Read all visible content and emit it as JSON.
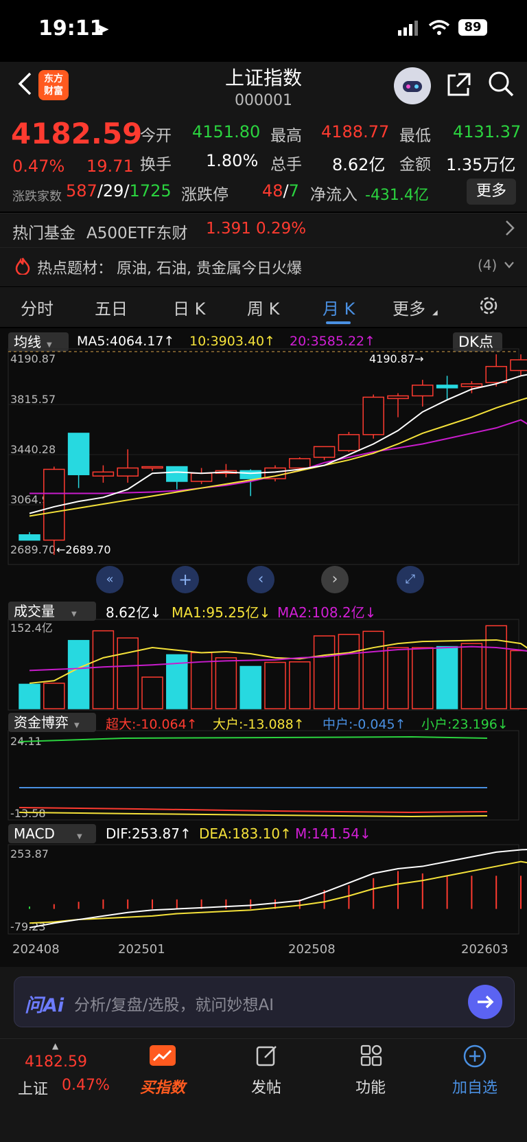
{
  "status_bar": {
    "time": "19:11",
    "battery": "89"
  },
  "header": {
    "title": "上证指数",
    "code": "000001",
    "logo_line1": "东方",
    "logo_line2": "财富"
  },
  "quote": {
    "price": "4182.59",
    "change_pct": "0.47%",
    "change": "19.71",
    "open_label": "今开",
    "open": "4151.80",
    "high_label": "最高",
    "high": "4188.77",
    "low_label": "最低",
    "low": "4131.37",
    "turnover_label": "换手",
    "turnover": "1.80%",
    "volume_label": "总手",
    "volume": "8.62亿",
    "amount_label": "金额",
    "amount": "1.35万亿",
    "breadth_label": "涨跌家数",
    "breadth_up": "587",
    "breadth_sep1": "/",
    "breadth_flat": "29",
    "breadth_sep2": "/",
    "breadth_down": "1725",
    "limit_label": "涨跌停",
    "limit_up": "48",
    "limit_sep": "/",
    "limit_down": "7",
    "netflow_label": "净流入",
    "netflow": "-431.4亿",
    "more": "更多"
  },
  "fund": {
    "label": "热门基金",
    "name": "A500ETF东财",
    "price": "1.391",
    "pct": "0.29%"
  },
  "hot": {
    "label": "热点题材：",
    "text": "原油, 石油, 贵金属今日火爆",
    "count": "(4)"
  },
  "tabs": [
    "分时",
    "五日",
    "日 K",
    "周 K",
    "月 K",
    "更多"
  ],
  "active_tab": "月 K",
  "ma": {
    "selector": "均线",
    "ma5": "MA5:4064.17↑",
    "ma10": "10:3903.40↑",
    "ma20": "20:3585.22↑",
    "dk": "DK点"
  },
  "price_axis": {
    "top": "4190.87",
    "l2": "3815.57",
    "l3": "3440.28",
    "l4": "3064.99",
    "bottom": "2689.70",
    "max_mark": "4190.87→",
    "min_mark": "←2689.70"
  },
  "volume_panel": {
    "selector": "成交量",
    "vol": "8.62亿↓",
    "ma1": "MA1:95.25亿↓",
    "ma2": "MA2:108.2亿↓",
    "top": "152.4亿"
  },
  "fund_panel": {
    "selector": "资金博弈",
    "super": "超大:-10.064↑",
    "large": "大户:-13.088↑",
    "mid": "中户:-0.045↑",
    "small": "小户:23.196↓",
    "top": "24.11",
    "bottom": "-13.58"
  },
  "macd_panel": {
    "selector": "MACD",
    "dif": "DIF:253.87↑",
    "dea": "DEA:183.10↑",
    "m": "M:141.54↓",
    "top": "253.87",
    "bottom": "-79.23"
  },
  "dates": [
    "202408",
    "202501",
    "202508",
    "202603"
  ],
  "ai": {
    "logo": "问Ai",
    "placeholder": "分析/复盘/选股，就问妙想AI"
  },
  "bottom": {
    "index_price": "4182.59",
    "index_name": "上证",
    "index_pct": "0.47%",
    "buy": "买指数",
    "post": "发帖",
    "func": "功能",
    "watch": "加自选"
  },
  "colors": {
    "up": "#ff3b30",
    "down": "#2bd33f",
    "bear_fill": "#27d9e0",
    "ma5": "#ffffff",
    "ma10": "#f5e23a",
    "ma20": "#c81ccc",
    "accent": "#4a90e2"
  },
  "chart_data": {
    "type": "candlestick",
    "candles": [
      {
        "o": 2840,
        "h": 2860,
        "l": 2800,
        "c": 2800
      },
      {
        "o": 2800,
        "h": 3350,
        "l": 2689.7,
        "c": 3330
      },
      {
        "o": 3600,
        "h": 3600,
        "l": 3190,
        "c": 3290
      },
      {
        "o": 3280,
        "h": 3360,
        "l": 3230,
        "c": 3310
      },
      {
        "o": 3280,
        "h": 3480,
        "l": 3230,
        "c": 3340
      },
      {
        "o": 3340,
        "h": 3350,
        "l": 3320,
        "c": 3350
      },
      {
        "o": 3350,
        "h": 3350,
        "l": 3180,
        "c": 3240
      },
      {
        "o": 3240,
        "h": 3340,
        "l": 3220,
        "c": 3300
      },
      {
        "o": 3300,
        "h": 3370,
        "l": 3270,
        "c": 3320
      },
      {
        "o": 3320,
        "h": 3330,
        "l": 3130,
        "c": 3260
      },
      {
        "o": 3260,
        "h": 3360,
        "l": 3240,
        "c": 3340
      },
      {
        "o": 3340,
        "h": 3420,
        "l": 3320,
        "c": 3410
      },
      {
        "o": 3420,
        "h": 3500,
        "l": 3400,
        "c": 3500
      },
      {
        "o": 3470,
        "h": 3610,
        "l": 3460,
        "c": 3590
      },
      {
        "o": 3590,
        "h": 3890,
        "l": 3560,
        "c": 3870
      },
      {
        "o": 3860,
        "h": 3900,
        "l": 3720,
        "c": 3880
      },
      {
        "o": 3880,
        "h": 4000,
        "l": 3800,
        "c": 3960
      },
      {
        "o": 3960,
        "h": 4030,
        "l": 3850,
        "c": 3940
      },
      {
        "o": 3950,
        "h": 3990,
        "l": 3900,
        "c": 3970
      },
      {
        "o": 3980,
        "h": 4190.87,
        "l": 3950,
        "c": 4100
      },
      {
        "o": 4070,
        "h": 4190.87,
        "l": 4030,
        "c": 4150
      },
      {
        "o": 4151.8,
        "h": 4188.77,
        "l": 4131.37,
        "c": 4182.59
      }
    ],
    "ma5": [
      3000,
      3050,
      3090,
      3120,
      3180,
      3300,
      3310,
      3300,
      3310,
      3300,
      3310,
      3330,
      3360,
      3440,
      3520,
      3620,
      3760,
      3850,
      3930,
      3970,
      4030,
      4064.17
    ],
    "ma10": [
      2980,
      3010,
      3040,
      3070,
      3100,
      3130,
      3160,
      3190,
      3220,
      3250,
      3280,
      3320,
      3360,
      3400,
      3450,
      3520,
      3600,
      3660,
      3720,
      3790,
      3850,
      3903.4
    ],
    "ma20": [
      3150,
      3150,
      3150,
      3150,
      3155,
      3160,
      3170,
      3190,
      3210,
      3240,
      3280,
      3320,
      3380,
      3420,
      3460,
      3490,
      3520,
      3560,
      3600,
      3640,
      3700,
      3585.22
    ],
    "volume": [
      48,
      50,
      134,
      153,
      139,
      62,
      106,
      110,
      100,
      83,
      91,
      92,
      143,
      146,
      152,
      120,
      120,
      122,
      128,
      163,
      114,
      8.62
    ],
    "vol_ma1": [
      50,
      55,
      80,
      100,
      110,
      120,
      115,
      110,
      112,
      108,
      100,
      98,
      105,
      110,
      120,
      128,
      132,
      133,
      134,
      135,
      128,
      95.25
    ],
    "vol_ma2": [
      75,
      77,
      79,
      82,
      84,
      86,
      89,
      92,
      94,
      95,
      96,
      100,
      102,
      108,
      112,
      116,
      118,
      120,
      122,
      120,
      115,
      108.2
    ],
    "macd_dif": [
      -79.23,
      -60,
      -45,
      -30,
      -15,
      -5,
      0,
      5,
      10,
      15,
      25,
      35,
      70,
      110,
      150,
      170,
      180,
      200,
      220,
      240,
      250,
      253.87
    ],
    "macd_dea": [
      -60,
      -55,
      -45,
      -40,
      -35,
      -30,
      -20,
      -15,
      -10,
      -5,
      5,
      15,
      30,
      55,
      85,
      105,
      120,
      140,
      160,
      180,
      200,
      183.1
    ],
    "macd_m": [
      10,
      20,
      30,
      40,
      40,
      40,
      40,
      40,
      40,
      40,
      40,
      40,
      80,
      100,
      130,
      160,
      150,
      140,
      140,
      140,
      140,
      141.54
    ],
    "price_range": [
      2689.7,
      4190.87
    ]
  }
}
